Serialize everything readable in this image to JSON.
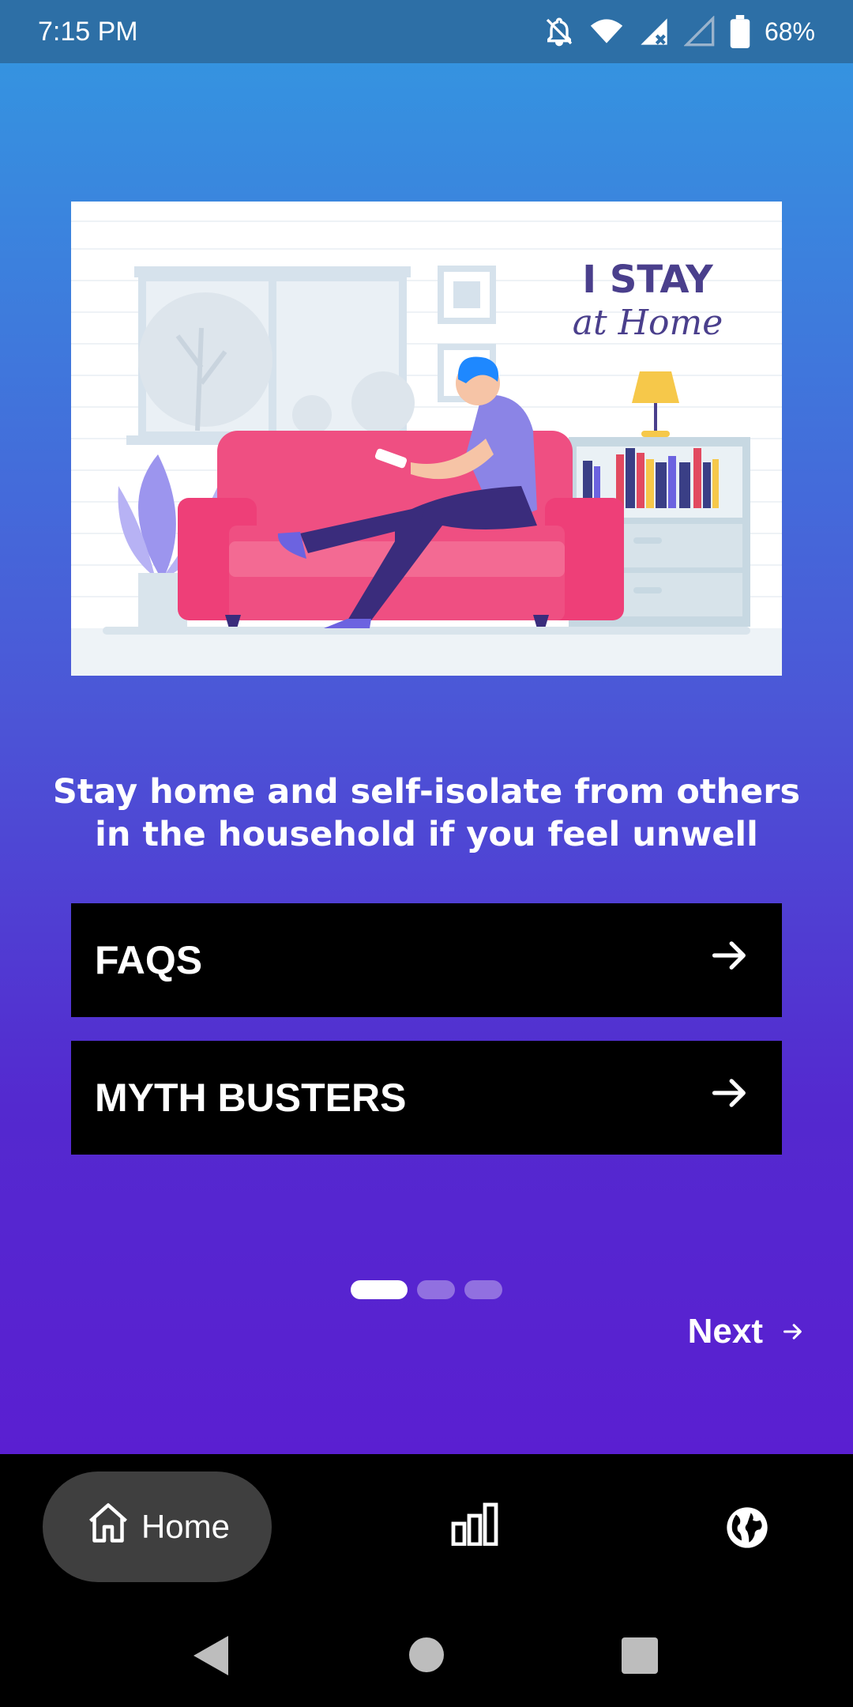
{
  "status": {
    "time": "7:15 PM",
    "battery": "68%",
    "icons": [
      "bell-off-icon",
      "wifi-icon",
      "signal-off-icon",
      "signal-empty-icon",
      "battery-icon"
    ]
  },
  "hero": {
    "line1": "I STAY",
    "line2": "at Home"
  },
  "lead_text": "Stay home and self-isolate from others in the household if you feel unwell",
  "buttons": {
    "faqs": "FAQS",
    "myth": "MYTH BUSTERS"
  },
  "pager": {
    "pages": 3,
    "active": 1
  },
  "next_label": "Next",
  "bottom_nav": {
    "home_label": "Home",
    "items": [
      "home-icon",
      "stats-icon",
      "globe-icon"
    ]
  },
  "colors": {
    "status_bar": "#2d6fa6",
    "gradient_top": "#3593e0",
    "gradient_bottom": "#5a1fd1",
    "button_bg": "#000000",
    "sofa": "#ee3f78",
    "person_shirt": "#8b84e6",
    "hero_text": "#4a3f8c"
  }
}
